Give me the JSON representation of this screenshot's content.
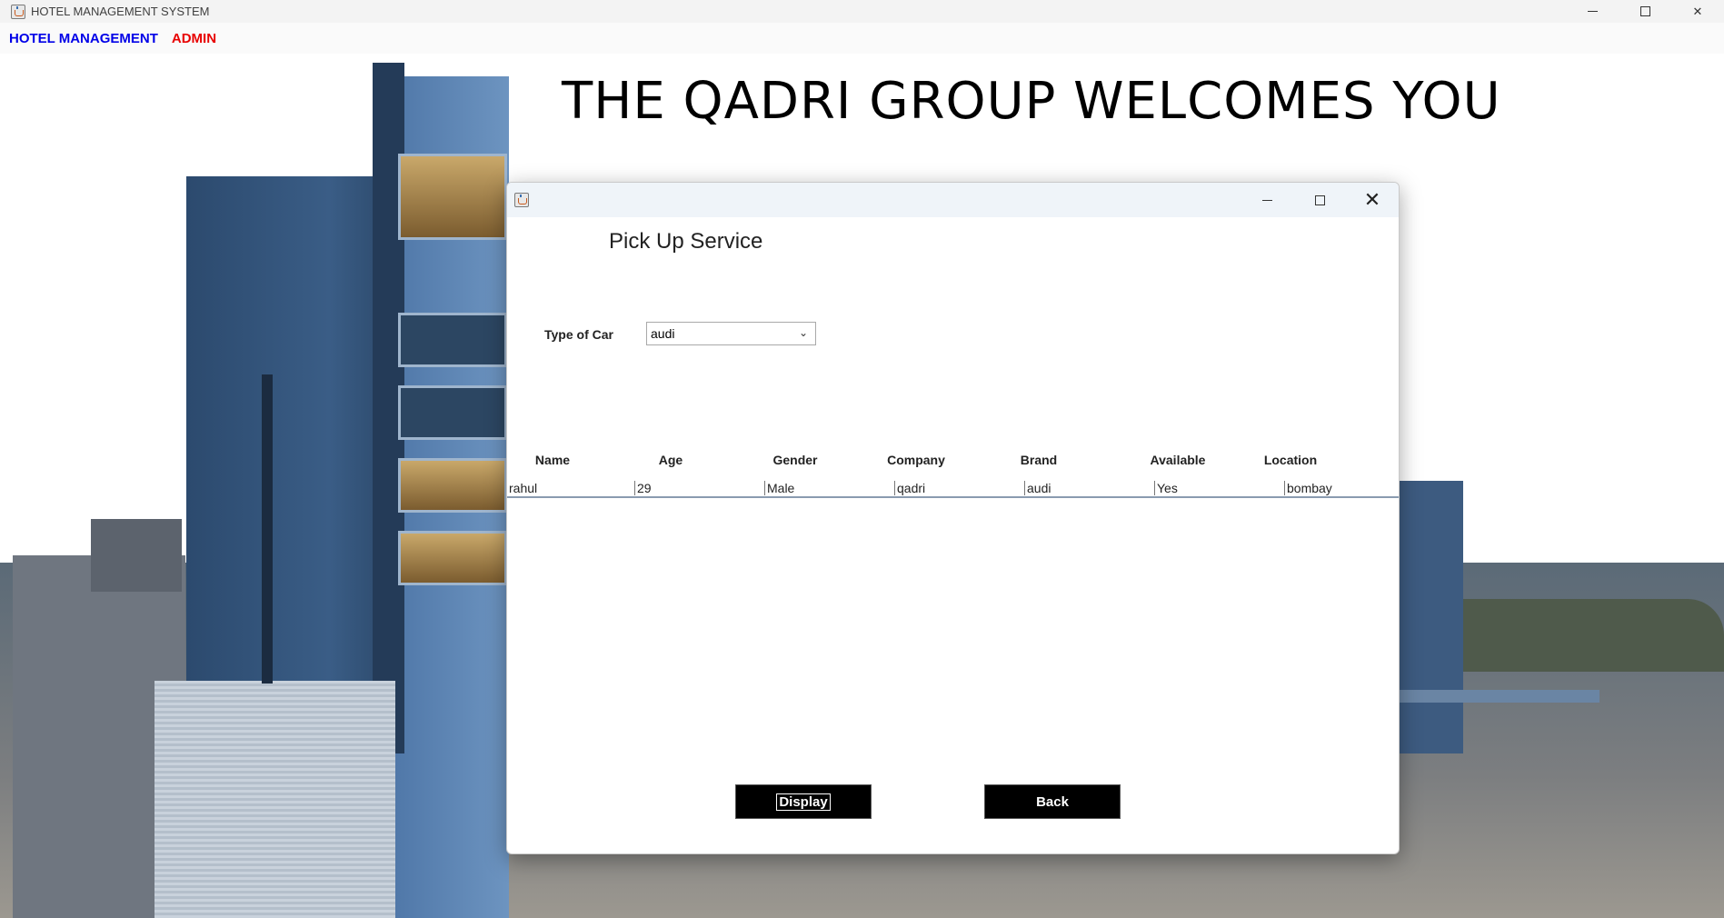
{
  "window": {
    "title": "HOTEL MANAGEMENT SYSTEM",
    "minimize_label": "—",
    "maximize_label": "",
    "close_label": "✕"
  },
  "menubar": {
    "items": [
      {
        "label": "HOTEL MANAGEMENT",
        "color": "#0000e8"
      },
      {
        "label": "ADMIN",
        "color": "#e80000"
      }
    ]
  },
  "background": {
    "headline": "THE QADRI GROUP WELCOMES YOU"
  },
  "dialog": {
    "heading": "Pick Up Service",
    "car_type": {
      "label": "Type of Car",
      "selected": "audi"
    },
    "table": {
      "columns": [
        "Name",
        "Age",
        "Gender",
        "Company",
        "Brand",
        "Available",
        "Location"
      ],
      "rows": [
        [
          "rahul",
          "29",
          "Male",
          "qadri",
          "audi",
          "Yes",
          "bombay"
        ]
      ]
    },
    "buttons": {
      "display": "Display",
      "back": "Back"
    }
  },
  "colors": {
    "button_bg": "#000000",
    "button_fg": "#ffffff"
  }
}
